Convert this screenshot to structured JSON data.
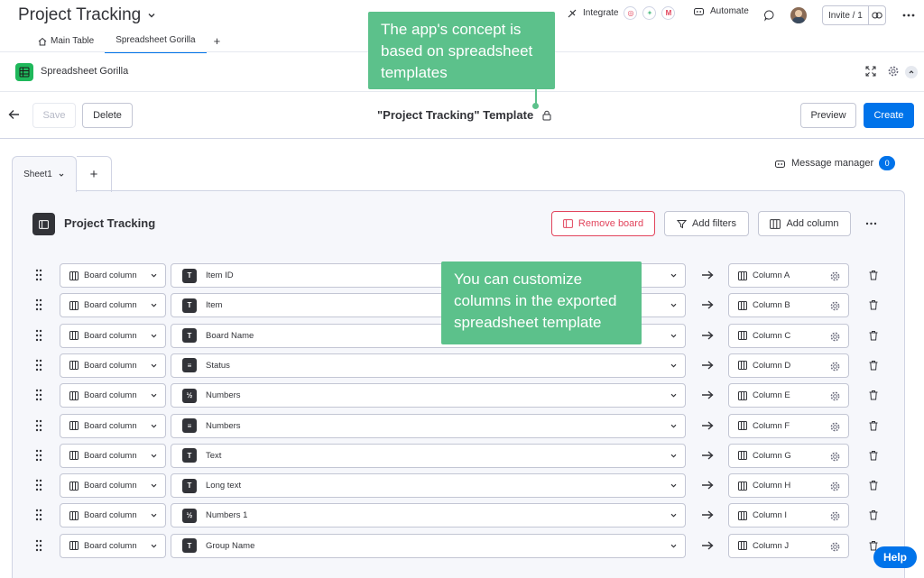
{
  "board": {
    "title": "Project Tracking"
  },
  "tabs": [
    {
      "label": "Main Table"
    },
    {
      "label": "Spreadsheet Gorilla"
    }
  ],
  "tab_add": "+",
  "topbar": {
    "integrate": "Integrate",
    "automate": "Automate",
    "invite": "Invite / 1"
  },
  "app": {
    "name": "Spreadsheet Gorilla"
  },
  "actions": {
    "save": "Save",
    "delete": "Delete",
    "template_title": "\"Project Tracking\" Template",
    "preview": "Preview",
    "create": "Create"
  },
  "sheets": {
    "active": "Sheet1",
    "add": "+"
  },
  "message_manager": {
    "label": "Message manager",
    "count": "0"
  },
  "panel": {
    "board_name": "Project Tracking",
    "remove_board": "Remove board",
    "add_filters": "Add filters",
    "add_column": "Add column"
  },
  "rows": [
    {
      "source": "Board column",
      "type_icon": "T",
      "field": "Item ID",
      "target": "Column A"
    },
    {
      "source": "Board column",
      "type_icon": "T",
      "field": "Item",
      "target": "Column B"
    },
    {
      "source": "Board column",
      "type_icon": "T",
      "field": "Board Name",
      "target": "Column C"
    },
    {
      "source": "Board column",
      "type_icon": "≡",
      "field": "Status",
      "target": "Column D"
    },
    {
      "source": "Board column",
      "type_icon": "½",
      "field": "Numbers",
      "target": "Column E"
    },
    {
      "source": "Board column",
      "type_icon": "≡",
      "field": "Numbers",
      "target": "Column F"
    },
    {
      "source": "Board column",
      "type_icon": "T",
      "field": "Text",
      "target": "Column G"
    },
    {
      "source": "Board column",
      "type_icon": "T",
      "field": "Long text",
      "target": "Column H"
    },
    {
      "source": "Board column",
      "type_icon": "½",
      "field": "Numbers 1",
      "target": "Column I"
    },
    {
      "source": "Board column",
      "type_icon": "T",
      "field": "Group Name",
      "target": "Column J"
    }
  ],
  "callouts": {
    "concept": "The app's concept is based on spreadsheet templates",
    "customize": "You can customize columns in the exported spreadsheet template"
  },
  "help": "Help",
  "colors": {
    "primary": "#0073ea",
    "callout": "#5cc18b",
    "danger": "#e2445c",
    "app_green": "#1fb85b"
  }
}
